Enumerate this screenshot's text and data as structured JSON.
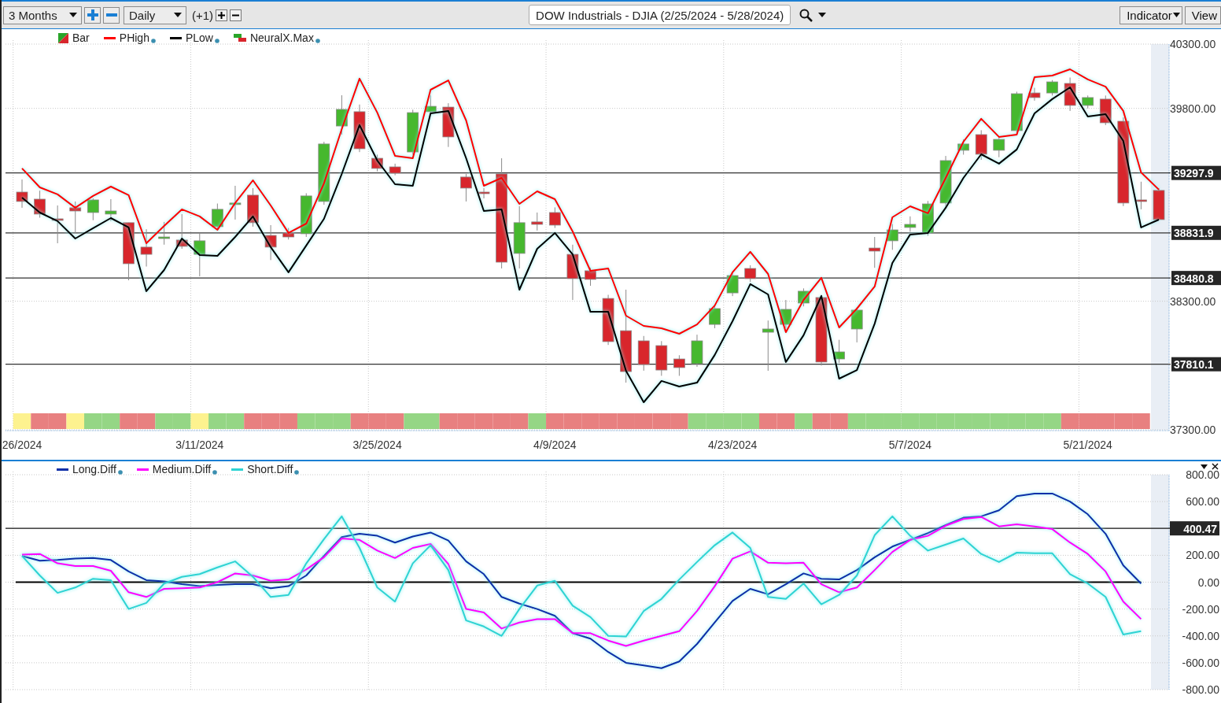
{
  "toolbar": {
    "period": "3 Months",
    "interval": "Daily",
    "offset": "(+1)",
    "title": "DOW Industrials - DJIA (2/25/2024 - 5/28/2024)",
    "buttons": [
      "Indicator",
      "View"
    ]
  },
  "price_pane": {
    "legend": [
      {
        "label": "Bar",
        "kind": "candles"
      },
      {
        "label": "NeuralX.Max",
        "kind": "band"
      }
    ],
    "chart_data": {
      "type": "candlestick",
      "ylim": [
        37300,
        40300
      ],
      "grid": true,
      "legend": "top",
      "categories": [
        "26/2024",
        null,
        null,
        null,
        null,
        null,
        null,
        null,
        null,
        null,
        "3/11/2024",
        null,
        null,
        null,
        null,
        null,
        null,
        null,
        null,
        null,
        "3/25/2024",
        null,
        null,
        null,
        null,
        null,
        null,
        null,
        null,
        null,
        "4/9/2024",
        null,
        null,
        null,
        null,
        null,
        null,
        null,
        null,
        null,
        "4/23/2024",
        null,
        null,
        null,
        null,
        null,
        null,
        null,
        null,
        null,
        "5/7/2024",
        null,
        null,
        null,
        null,
        null,
        null,
        null,
        null,
        null,
        "5/21/2024",
        null,
        null,
        null,
        null
      ],
      "yticks": [
        {
          "value": 40300,
          "label": "40300.00"
        },
        {
          "value": 39800,
          "label": "39800.00"
        },
        {
          "value": 38300,
          "label": "38300.00"
        },
        {
          "value": 37300,
          "label": "37300.00"
        }
      ],
      "series": [
        {
          "name": "PHigh",
          "type": "line",
          "color": "#ff0000",
          "values": [
            39333,
            39186,
            39131,
            39027,
            39119,
            39192,
            39125,
            38751,
            38886,
            39015,
            38960,
            38855,
            39064,
            39241,
            39045,
            38831,
            38904,
            39217,
            39639,
            40031,
            39767,
            39431,
            39412,
            39945,
            40018,
            39706,
            39198,
            39259,
            39057,
            39155,
            39094,
            38843,
            38537,
            38555,
            38188,
            38108,
            38090,
            38047,
            38120,
            38267,
            38525,
            38684,
            38512,
            38059,
            38310,
            38482,
            38096,
            38243,
            38415,
            38953,
            39039,
            38984,
            39259,
            39541,
            39719,
            39578,
            39596,
            40043,
            40055,
            40104,
            40025,
            39969,
            39780,
            39302,
            39168
          ]
        },
        {
          "name": "PLow",
          "type": "line",
          "color": "#000000",
          "values": [
            39106,
            38990,
            38923,
            38788,
            38868,
            38947,
            38874,
            38378,
            38543,
            38788,
            38659,
            38653,
            38800,
            38960,
            38721,
            38525,
            38733,
            38941,
            39290,
            39670,
            39394,
            39210,
            39198,
            39761,
            39780,
            39412,
            39002,
            39015,
            38390,
            38708,
            38831,
            38665,
            38218,
            38218,
            37759,
            37514,
            37680,
            37637,
            37667,
            37882,
            38145,
            38433,
            38353,
            37827,
            38035,
            38341,
            37698,
            37765,
            38126,
            38598,
            38819,
            38831,
            39027,
            39259,
            39443,
            39370,
            39480,
            39761,
            39872,
            39963,
            39737,
            39755,
            39547,
            38874,
            38935
          ]
        }
      ],
      "ohlc": [
        [
          39149,
          39247,
          39027,
          39076
        ],
        [
          39094,
          39160,
          38950,
          38978
        ],
        [
          38941,
          39045,
          38751,
          38935
        ],
        [
          39027,
          39076,
          38831,
          39002
        ],
        [
          38990,
          39100,
          38930,
          39088
        ],
        [
          38978,
          39094,
          38923,
          39002
        ],
        [
          38911,
          38911,
          38463,
          38592
        ],
        [
          38721,
          38860,
          38570,
          38665
        ],
        [
          38794,
          38917,
          38740,
          38800
        ],
        [
          38776,
          38978,
          38708,
          38727
        ],
        [
          38665,
          38831,
          38494,
          38770
        ],
        [
          38880,
          39060,
          38860,
          39015
        ],
        [
          39057,
          39198,
          38935,
          39064
        ],
        [
          39125,
          39180,
          38880,
          38911
        ],
        [
          38812,
          38892,
          38620,
          38721
        ],
        [
          38831,
          38870,
          38780,
          38800
        ],
        [
          38825,
          39140,
          38800,
          39119
        ],
        [
          39076,
          39540,
          39050,
          39523
        ],
        [
          39663,
          39902,
          39596,
          39792
        ],
        [
          39774,
          39830,
          39460,
          39486
        ],
        [
          39412,
          39440,
          39310,
          39333
        ],
        [
          39345,
          39370,
          39280,
          39296
        ],
        [
          39461,
          39790,
          39440,
          39767
        ],
        [
          39774,
          39900,
          39750,
          39816
        ],
        [
          39810,
          39840,
          39500,
          39578
        ],
        [
          39266,
          39290,
          39076,
          39180
        ],
        [
          39149,
          39180,
          39100,
          39137
        ],
        [
          39290,
          39412,
          38555,
          38604
        ],
        [
          38672,
          39039,
          38555,
          38911
        ],
        [
          38917,
          38990,
          38850,
          38898
        ],
        [
          38990,
          39030,
          38870,
          38892
        ],
        [
          38665,
          38740,
          38310,
          38476
        ],
        [
          38537,
          38560,
          38420,
          38470
        ],
        [
          38322,
          38350,
          37960,
          37986
        ],
        [
          38071,
          38390,
          37667,
          37753
        ],
        [
          37992,
          38030,
          37760,
          37808
        ],
        [
          37955,
          37990,
          37720,
          37765
        ],
        [
          37851,
          37880,
          37720,
          37784
        ],
        [
          37814,
          38040,
          37790,
          37992
        ],
        [
          38120,
          38270,
          38090,
          38243
        ],
        [
          38365,
          38530,
          38340,
          38500
        ],
        [
          38555,
          38580,
          38450,
          38476
        ],
        [
          38059,
          38150,
          37759,
          38084
        ],
        [
          38120,
          38310,
          38090,
          38237
        ],
        [
          38286,
          38400,
          38260,
          38378
        ],
        [
          38329,
          38350,
          37800,
          37827
        ],
        [
          37851,
          38000,
          37820,
          37906
        ],
        [
          38084,
          38250,
          37980,
          38231
        ],
        [
          38714,
          38800,
          38560,
          38690
        ],
        [
          38770,
          38900,
          38700,
          38855
        ],
        [
          38874,
          38960,
          38840,
          38898
        ],
        [
          38831,
          39080,
          38810,
          39057
        ],
        [
          39064,
          39430,
          39020,
          39394
        ],
        [
          39474,
          39560,
          39440,
          39523
        ],
        [
          39596,
          39630,
          39400,
          39443
        ],
        [
          39474,
          39580,
          39420,
          39559
        ],
        [
          39627,
          39930,
          39600,
          39914
        ],
        [
          39920,
          39960,
          39860,
          39884
        ],
        [
          39920,
          40020,
          39900,
          40006
        ],
        [
          39994,
          40040,
          39780,
          39823
        ],
        [
          39823,
          39900,
          39800,
          39884
        ],
        [
          39872,
          39900,
          39670,
          39688
        ],
        [
          39700,
          39730,
          39040,
          39064
        ],
        [
          39088,
          39230,
          39015,
          39076
        ],
        [
          39162,
          39180,
          38935,
          38935
        ]
      ],
      "ref_lines": [
        {
          "axis": "y",
          "value": 39297.9,
          "label": "39297.9"
        },
        {
          "axis": "y",
          "value": 38831.9,
          "label": "38831.9"
        },
        {
          "axis": "y",
          "value": 38480.8,
          "label": "38480.8"
        },
        {
          "axis": "y",
          "value": 37810.1,
          "label": "37810.1"
        }
      ]
    },
    "signal_band": [
      {
        "color": "#fdf28f"
      },
      {
        "color": "#e88080"
      },
      {
        "color": "#e88080"
      },
      {
        "color": "#fdf28f"
      },
      {
        "color": "#95d685"
      },
      {
        "color": "#95d685"
      },
      {
        "color": "#e88080"
      },
      {
        "color": "#e88080"
      },
      {
        "color": "#95d685"
      },
      {
        "color": "#95d685"
      },
      {
        "color": "#fdf28f"
      },
      {
        "color": "#95d685"
      },
      {
        "color": "#95d685"
      },
      {
        "color": "#e88080"
      },
      {
        "color": "#e88080"
      },
      {
        "color": "#e88080"
      },
      {
        "color": "#95d685"
      },
      {
        "color": "#95d685"
      },
      {
        "color": "#95d685"
      },
      {
        "color": "#e88080"
      },
      {
        "color": "#e88080"
      },
      {
        "color": "#e88080"
      },
      {
        "color": "#95d685"
      },
      {
        "color": "#95d685"
      },
      {
        "color": "#e88080"
      },
      {
        "color": "#e88080"
      },
      {
        "color": "#e88080"
      },
      {
        "color": "#e88080"
      },
      {
        "color": "#e88080"
      },
      {
        "color": "#95d685"
      },
      {
        "color": "#e88080"
      },
      {
        "color": "#e88080"
      },
      {
        "color": "#e88080"
      },
      {
        "color": "#e88080"
      },
      {
        "color": "#e88080"
      },
      {
        "color": "#e88080"
      },
      {
        "color": "#e88080"
      },
      {
        "color": "#e88080"
      },
      {
        "color": "#95d685"
      },
      {
        "color": "#95d685"
      },
      {
        "color": "#95d685"
      },
      {
        "color": "#95d685"
      },
      {
        "color": "#e88080"
      },
      {
        "color": "#e88080"
      },
      {
        "color": "#95d685"
      },
      {
        "color": "#e88080"
      },
      {
        "color": "#e88080"
      },
      {
        "color": "#95d685"
      },
      {
        "color": "#95d685"
      },
      {
        "color": "#95d685"
      },
      {
        "color": "#95d685"
      },
      {
        "color": "#95d685"
      },
      {
        "color": "#95d685"
      },
      {
        "color": "#95d685"
      },
      {
        "color": "#95d685"
      },
      {
        "color": "#95d685"
      },
      {
        "color": "#95d685"
      },
      {
        "color": "#95d685"
      },
      {
        "color": "#95d685"
      },
      {
        "color": "#e88080"
      },
      {
        "color": "#e88080"
      },
      {
        "color": "#e88080"
      },
      {
        "color": "#e88080"
      },
      {
        "color": "#e88080"
      }
    ]
  },
  "indicator_pane": {
    "chart_data": {
      "type": "line",
      "ylim": [
        -800,
        800
      ],
      "grid": true,
      "legend": "top",
      "yticks": [
        {
          "value": 800,
          "label": "800.00"
        },
        {
          "value": 600,
          "label": "600.00"
        },
        {
          "value": 200,
          "label": "200.00"
        },
        {
          "value": 0,
          "label": "0.00"
        },
        {
          "value": -200,
          "label": "-200.00"
        },
        {
          "value": -400,
          "label": "-400.00"
        },
        {
          "value": -600,
          "label": "-600.00"
        },
        {
          "value": -800,
          "label": "-800.00"
        }
      ],
      "series": [
        {
          "name": "Long.Diff",
          "color": "#0d2fa8",
          "values": [
            195,
            160,
            165,
            175,
            180,
            165,
            80,
            15,
            5,
            -15,
            -30,
            -20,
            -15,
            -15,
            -45,
            -30,
            50,
            195,
            335,
            360,
            345,
            295,
            340,
            370,
            310,
            155,
            60,
            -110,
            -160,
            -200,
            -250,
            -380,
            -420,
            -520,
            -600,
            -620,
            -640,
            -590,
            -460,
            -300,
            -140,
            -50,
            -90,
            -15,
            65,
            25,
            20,
            90,
            185,
            265,
            315,
            365,
            425,
            480,
            490,
            535,
            640,
            660,
            660,
            600,
            505,
            360,
            125,
            -10
          ]
        },
        {
          "name": "Medium.Diff",
          "color": "#ff00ff",
          "values": [
            205,
            210,
            140,
            120,
            120,
            85,
            -75,
            -110,
            -50,
            -45,
            -40,
            0,
            65,
            50,
            10,
            20,
            95,
            185,
            325,
            315,
            235,
            180,
            255,
            285,
            135,
            -200,
            -225,
            -345,
            -300,
            -275,
            -275,
            -380,
            -380,
            -435,
            -475,
            -435,
            -400,
            -365,
            -215,
            -30,
            175,
            230,
            145,
            140,
            145,
            -15,
            -75,
            -40,
            90,
            225,
            315,
            345,
            420,
            470,
            485,
            415,
            430,
            415,
            395,
            295,
            210,
            80,
            -145,
            -275
          ]
        },
        {
          "name": "Short.Diff",
          "color": "#2ed3d3",
          "values": [
            195,
            50,
            -80,
            -40,
            25,
            15,
            -200,
            -155,
            -10,
            40,
            60,
            110,
            155,
            40,
            -110,
            -95,
            140,
            320,
            490,
            255,
            -40,
            -145,
            140,
            275,
            90,
            -285,
            -330,
            -400,
            -200,
            -25,
            10,
            -175,
            -260,
            -400,
            -405,
            -215,
            -125,
            20,
            150,
            275,
            370,
            255,
            -110,
            -125,
            -10,
            -165,
            -95,
            50,
            350,
            490,
            345,
            235,
            280,
            325,
            210,
            150,
            220,
            215,
            215,
            60,
            -10,
            -110,
            -390,
            -365
          ]
        }
      ],
      "ref_lines": [
        {
          "axis": "y",
          "value": 400.47,
          "label": "400.47"
        }
      ]
    }
  }
}
